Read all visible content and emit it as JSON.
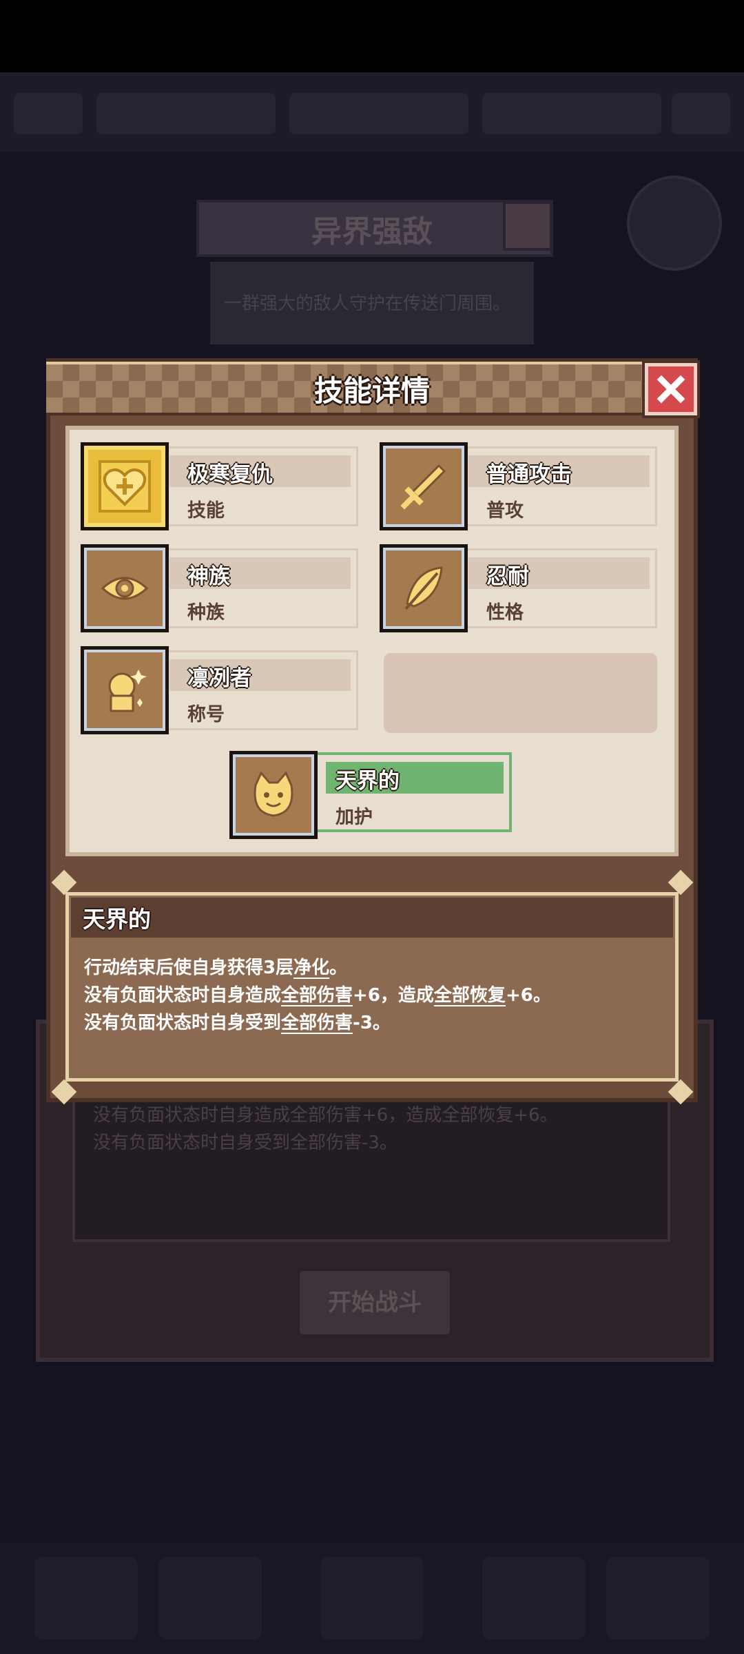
{
  "background": {
    "title": "异界强敌",
    "subtitle": "一群强大的敌人守护在传送门周围。",
    "bg_desc_line2": "没有负面状态时自身造成全部伤害+6，造成全部恢复+6。",
    "bg_desc_line3": "没有负面状态时自身受到全部伤害-3。",
    "start_button": "开始战斗"
  },
  "dialog": {
    "title": "技能详情",
    "skills": [
      {
        "name": "极寒复仇",
        "type": "技能",
        "icon": "heart-shield-icon",
        "rarity": "gold"
      },
      {
        "name": "普通攻击",
        "type": "普攻",
        "icon": "sword-icon",
        "rarity": "normal"
      },
      {
        "name": "神族",
        "type": "种族",
        "icon": "eye-emblem-icon",
        "rarity": "normal"
      },
      {
        "name": "忍耐",
        "type": "性格",
        "icon": "feather-icon",
        "rarity": "normal"
      },
      {
        "name": "凛冽者",
        "type": "称号",
        "icon": "creature-icon",
        "rarity": "normal"
      }
    ],
    "selected": {
      "name": "天界的",
      "type": "加护",
      "icon": "cat-face-icon"
    },
    "description": {
      "title": "天界的",
      "line1": {
        "a": "行动结束后使自身获得3层",
        "b": "净化",
        "c": "。"
      },
      "line2": {
        "a": "没有负面状态时自身造成",
        "b": "全部伤害",
        "c": "+6，造成",
        "d": "全部恢复",
        "e": "+6。"
      },
      "line3": {
        "a": "没有负面状态时自身受到",
        "b": "全部伤害",
        "c": "-3。"
      }
    }
  },
  "colors": {
    "dialog_brown": "#6e4c3b",
    "panel_cream": "#e9dfd0",
    "selected_green": "#6fb571",
    "close_red": "#d5484b"
  }
}
